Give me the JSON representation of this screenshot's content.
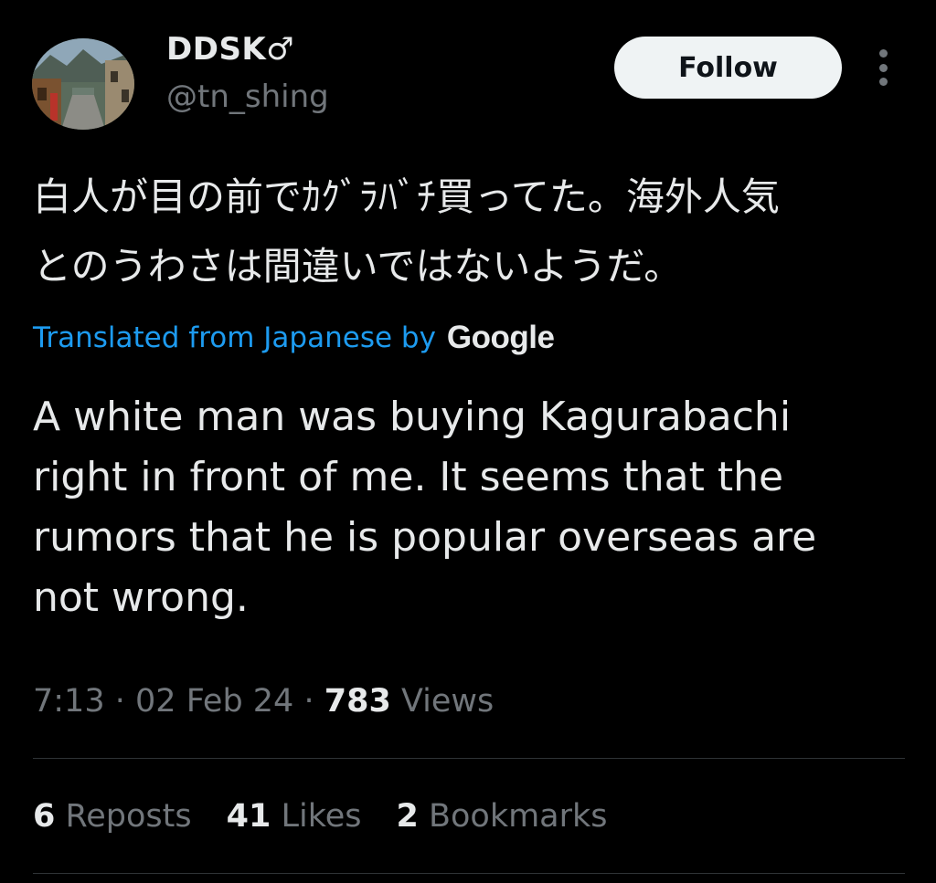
{
  "user": {
    "display_name": "DDSK♂",
    "handle": "@tn_shing"
  },
  "follow_button": {
    "label": "Follow"
  },
  "tweet": {
    "original_lines": [
      "白人が目の前でｶｸﾞﾗﾊﾞﾁ買ってた。海外人気",
      "とのうわさは間違いではないようだ。"
    ],
    "translation_label": "Translated from Japanese by",
    "translation_provider": "Google",
    "translated_lines": [
      "A white man was buying Kagurabachi",
      "right in front of me. It seems that the",
      "rumors that he is popular overseas are",
      "not wrong."
    ]
  },
  "meta": {
    "time": "7:13",
    "separator": "·",
    "date": "02 Feb 24",
    "views_count": "783",
    "views_label": "Views"
  },
  "stats": {
    "reposts_count": "6",
    "reposts_label": "Reposts",
    "likes_count": "41",
    "likes_label": "Likes",
    "bookmarks_count": "2",
    "bookmarks_label": "Bookmarks"
  },
  "colors": {
    "background": "#000000",
    "primary_text": "#e7e9ea",
    "secondary_text": "#71767b",
    "link_blue": "#1d9bf0",
    "divider": "#2f3336"
  }
}
